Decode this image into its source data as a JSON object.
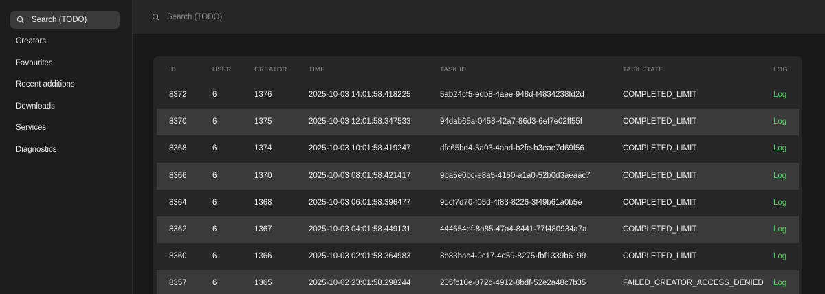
{
  "sidebar": {
    "search_label": "Search (TODO)",
    "nav": [
      {
        "label": "Creators"
      },
      {
        "label": "Favourites"
      },
      {
        "label": "Recent additions"
      },
      {
        "label": "Downloads"
      },
      {
        "label": "Services"
      },
      {
        "label": "Diagnostics"
      }
    ]
  },
  "topbar": {
    "search_placeholder": "Search (TODO)"
  },
  "table": {
    "headers": {
      "id": "ID",
      "user": "USER",
      "creator": "CREATOR",
      "time": "TIME",
      "task_id": "TASK ID",
      "task_state": "TASK STATE",
      "log": "LOG"
    },
    "rows": [
      {
        "id": "8372",
        "user": "6",
        "creator": "1376",
        "time": "2025-10-03 14:01:58.418225",
        "task_id": "5ab24cf5-edb8-4aee-948d-f4834238fd2d",
        "task_state": "COMPLETED_LIMIT",
        "log": "Log"
      },
      {
        "id": "8370",
        "user": "6",
        "creator": "1375",
        "time": "2025-10-03 12:01:58.347533",
        "task_id": "94dab65a-0458-42a7-86d3-6ef7e02ff55f",
        "task_state": "COMPLETED_LIMIT",
        "log": "Log"
      },
      {
        "id": "8368",
        "user": "6",
        "creator": "1374",
        "time": "2025-10-03 10:01:58.419247",
        "task_id": "dfc65bd4-5a03-4aad-b2fe-b3eae7d69f56",
        "task_state": "COMPLETED_LIMIT",
        "log": "Log"
      },
      {
        "id": "8366",
        "user": "6",
        "creator": "1370",
        "time": "2025-10-03 08:01:58.421417",
        "task_id": "9ba5e0bc-e8a5-4150-a1a0-52b0d3aeaac7",
        "task_state": "COMPLETED_LIMIT",
        "log": "Log"
      },
      {
        "id": "8364",
        "user": "6",
        "creator": "1368",
        "time": "2025-10-03 06:01:58.396477",
        "task_id": "9dcf7d70-f05d-4f83-8226-3f49b61a0b5e",
        "task_state": "COMPLETED_LIMIT",
        "log": "Log"
      },
      {
        "id": "8362",
        "user": "6",
        "creator": "1367",
        "time": "2025-10-03 04:01:58.449131",
        "task_id": "444654ef-8a85-47a4-8441-77f480934a7a",
        "task_state": "COMPLETED_LIMIT",
        "log": "Log"
      },
      {
        "id": "8360",
        "user": "6",
        "creator": "1366",
        "time": "2025-10-03 02:01:58.364983",
        "task_id": "8b83bac4-0c17-4d59-8275-fbf1339b6199",
        "task_state": "COMPLETED_LIMIT",
        "log": "Log"
      },
      {
        "id": "8357",
        "user": "6",
        "creator": "1365",
        "time": "2025-10-02 23:01:58.298244",
        "task_id": "205fc10e-072d-4912-8bdf-52e2a48c7b35",
        "task_state": "FAILED_CREATOR_ACCESS_DENIED",
        "log": "Log"
      }
    ]
  },
  "colors": {
    "log_link": "#4ccf5a",
    "row_alt": "#3a3a3a",
    "panel": "#262626"
  }
}
